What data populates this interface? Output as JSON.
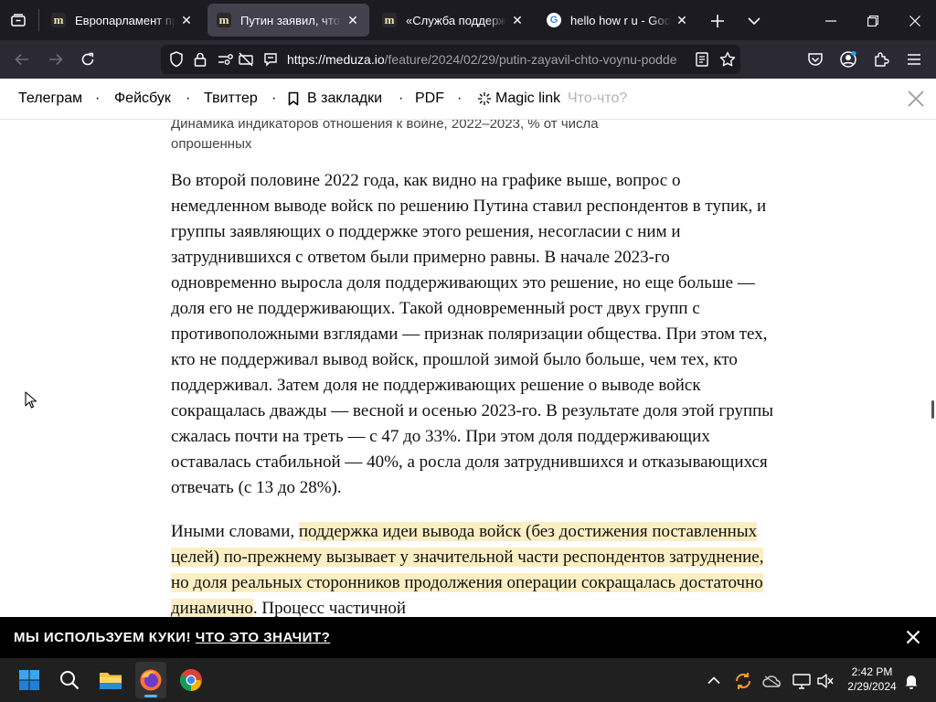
{
  "tabs": [
    {
      "title": "Европарламент прин…",
      "favicon": "meduza-favicon"
    },
    {
      "title": "Путин заявил, что вой…",
      "favicon": "meduza-favicon",
      "active": true
    },
    {
      "title": "«Служба поддержки»…",
      "favicon": "meduza-favicon"
    },
    {
      "title": "hello how r u - Google",
      "favicon": "google-favicon"
    }
  ],
  "address_bar": {
    "host": "https://meduza.io",
    "path": "/feature/2024/02/29/putin-zayavil-chto-voynu-podde"
  },
  "share_bar": {
    "items": [
      "Телеграм",
      "Фейсбук",
      "Твиттер",
      "В закладки",
      "PDF",
      "Magic link"
    ],
    "whats_this": "Что-что?"
  },
  "article": {
    "chart_caption": "Динамика индикаторов отношения к войне, 2022–2023, % от числа опрошенных",
    "paragraph1": "Во второй половине 2022 года, как видно на графике выше, вопрос о немедленном выводе войск по решению Путина ставил респондентов в тупик, и группы заявляющих о поддержке этого решения, несогласии с ним и затруднившихся с ответом были примерно равны. В начале 2023-го одновременно выросла доля поддерживающих это решение, но еще больше — доля его не поддерживающих. Такой одновременный рост двух групп с противоположными взглядами — признак поляризации общества. При этом тех, кто не поддерживал вывод войск, прошлой зимой было больше, чем тех, кто поддерживал. Затем доля не поддерживающих решение о выводе войск сокращалась дважды — весной и осенью 2023-го. В результате доля этой группы сжалась почти на треть — с 47 до 33%. При этом доля поддерживающих оставалась стабильной — 40%, а росла доля затруднившихся и отказывающихся отвечать (с 13 до 28%).",
    "paragraph2_lead": "Иными словами, ",
    "paragraph2_highlight": "поддержка идеи вывода войск (без достижения поставленных целей) по-прежнему вызывает у значительной части респондентов затруднение, но доля реальных сторонников продолжения операции сокращалась достаточно динамично",
    "paragraph2_tail": ". Процесс частичной"
  },
  "cookie_banner": {
    "text": "МЫ ИСПОЛЬЗУЕМ КУКИ!",
    "link": "ЧТО ЭТО ЗНАЧИТ?"
  },
  "taskbar": {
    "time": "2:42 PM",
    "date": "2/29/2024"
  },
  "colors": {
    "highlight": "#fbeec2",
    "browser_chrome": "#1c1b22",
    "cookie_bar": "#000000"
  }
}
